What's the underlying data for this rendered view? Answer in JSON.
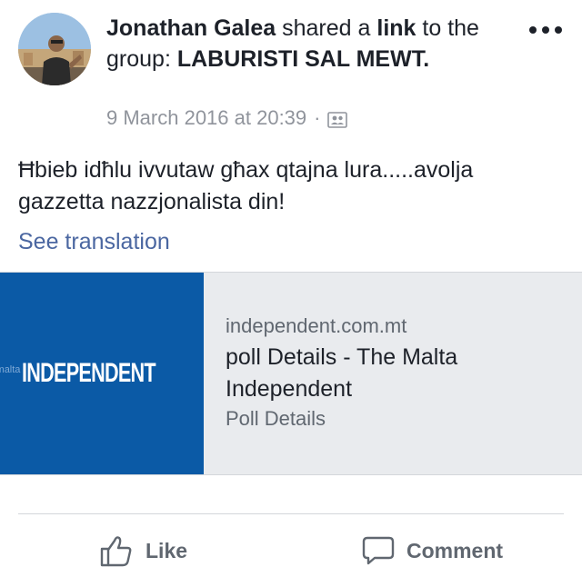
{
  "post": {
    "author": "Jonathan Galea",
    "shared_text": "shared a",
    "link_word": "link",
    "to_text": "to the group:",
    "group": "LABURISTI SAL MEWT.",
    "timestamp": "9 March 2016 at 20:39",
    "separator": "·",
    "audience_icon": "group-icon",
    "message": "Ħbieb idħlu ivvutaw għax qtajna lura.....avolja gazzetta nazzjonalista din!",
    "see_translation": "See translation"
  },
  "link_card": {
    "thumb_small": "malta",
    "thumb_brand": "INDEPENDENT",
    "domain": "independent.com.mt",
    "title": "poll Details - The Malta Independent",
    "description": "Poll Details"
  },
  "actions": {
    "like_label": "Like",
    "comment_label": "Comment"
  },
  "colors": {
    "link_blue": "#4b67a1",
    "thumb_bg": "#0b5aa6",
    "card_bg": "#e9ebee",
    "meta_gray": "#90949c"
  }
}
